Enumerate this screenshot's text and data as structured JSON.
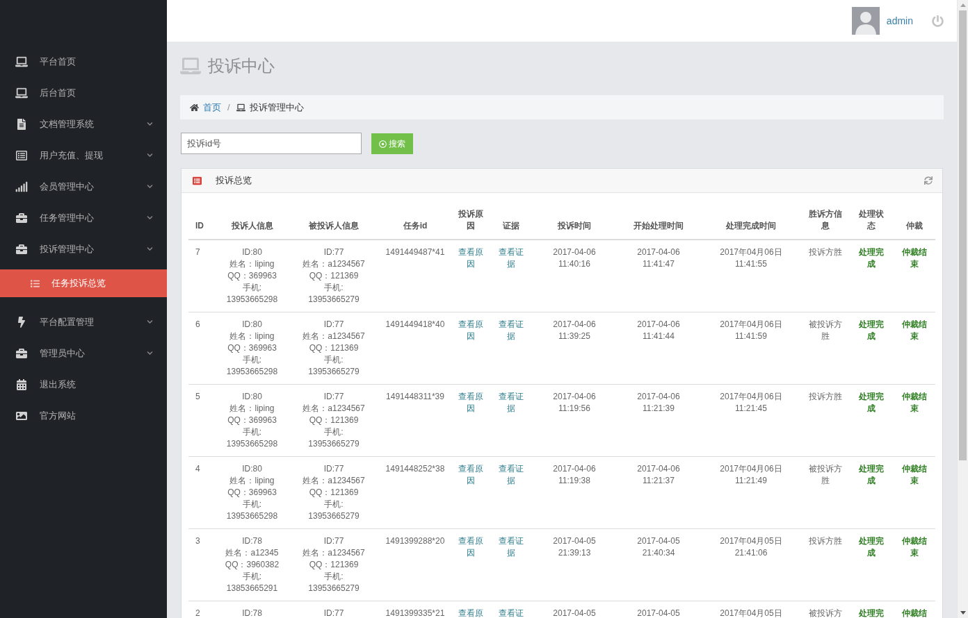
{
  "sidebar": {
    "items": [
      {
        "label": "平台首页",
        "kind": "link",
        "selected": false
      },
      {
        "label": "后台首页",
        "kind": "link",
        "selected": false
      },
      {
        "label": "文档管理系统",
        "kind": "submenu",
        "selected": false
      },
      {
        "label": "用户充值、提现",
        "kind": "submenu",
        "selected": false
      },
      {
        "label": "会员管理中心",
        "kind": "submenu",
        "selected": false
      },
      {
        "label": "任务管理中心",
        "kind": "submenu",
        "selected": false
      },
      {
        "label": "投诉管理中心",
        "kind": "submenu",
        "selected": false,
        "children": [
          {
            "label": "任务投诉总览",
            "selected": true
          }
        ]
      },
      {
        "label": "平台配置管理",
        "kind": "submenu",
        "selected": false
      },
      {
        "label": "管理员中心",
        "kind": "submenu",
        "selected": false
      },
      {
        "label": "退出系统",
        "kind": "link",
        "selected": false
      },
      {
        "label": "官方网站",
        "kind": "link",
        "selected": false
      }
    ]
  },
  "top_bar": {
    "user": "admin"
  },
  "page_title": "投诉中心",
  "breadcrumb": {
    "items": [
      {
        "label": "首页",
        "kind": "link"
      },
      {
        "label": "投诉管理中心",
        "kind": "current"
      }
    ],
    "separator": "/"
  },
  "search": {
    "placeholder": "投诉id号",
    "button": "搜索"
  },
  "panel": {
    "title": "投诉总览",
    "table": {
      "columns": [
        "ID",
        "投诉人信息",
        "被投诉人信息",
        "任务id",
        "投诉原因",
        "证据",
        "投诉时间",
        "开始处理时间",
        "处理完成时间",
        "胜诉方信息",
        "处理状态",
        "仲裁"
      ],
      "rows": [
        {
          "id": "7",
          "complainant": [
            "ID:80",
            "姓名：liping",
            "QQ：369963",
            "手机:",
            "13953665298"
          ],
          "respondent": [
            "ID:77",
            "姓名：a1234567",
            "QQ：121369",
            "手机:",
            "13953665279"
          ],
          "task_id": "1491449487*41",
          "reason": "查看原因",
          "evidence": "查看证据",
          "complaint_time": [
            "2017-04-06",
            "11:40:16"
          ],
          "start_time": [
            "2017-04-06",
            "11:41:47"
          ],
          "finish_time": [
            "2017年04月06日",
            "11:41:55"
          ],
          "winner": "投诉方胜",
          "status": "处理完成",
          "arbitration": "仲裁结束"
        },
        {
          "id": "6",
          "complainant": [
            "ID:80",
            "姓名：liping",
            "QQ：369963",
            "手机:",
            "13953665298"
          ],
          "respondent": [
            "ID:77",
            "姓名：a1234567",
            "QQ：121369",
            "手机:",
            "13953665279"
          ],
          "task_id": "1491449418*40",
          "reason": "查看原因",
          "evidence": "查看证据",
          "complaint_time": [
            "2017-04-06",
            "11:39:25"
          ],
          "start_time": [
            "2017-04-06",
            "11:41:44"
          ],
          "finish_time": [
            "2017年04月06日",
            "11:41:59"
          ],
          "winner": "被投诉方胜",
          "status": "处理完成",
          "arbitration": "仲裁结束"
        },
        {
          "id": "5",
          "complainant": [
            "ID:80",
            "姓名：liping",
            "QQ：369963",
            "手机:",
            "13953665298"
          ],
          "respondent": [
            "ID:77",
            "姓名：a1234567",
            "QQ：121369",
            "手机:",
            "13953665279"
          ],
          "task_id": "1491448311*39",
          "reason": "查看原因",
          "evidence": "查看证据",
          "complaint_time": [
            "2017-04-06",
            "11:19:56"
          ],
          "start_time": [
            "2017-04-06",
            "11:21:39"
          ],
          "finish_time": [
            "2017年04月06日",
            "11:21:45"
          ],
          "winner": "投诉方胜",
          "status": "处理完成",
          "arbitration": "仲裁结束"
        },
        {
          "id": "4",
          "complainant": [
            "ID:80",
            "姓名：liping",
            "QQ：369963",
            "手机:",
            "13953665298"
          ],
          "respondent": [
            "ID:77",
            "姓名：a1234567",
            "QQ：121369",
            "手机:",
            "13953665279"
          ],
          "task_id": "1491448252*38",
          "reason": "查看原因",
          "evidence": "查看证据",
          "complaint_time": [
            "2017-04-06",
            "11:19:38"
          ],
          "start_time": [
            "2017-04-06",
            "11:21:37"
          ],
          "finish_time": [
            "2017年04月06日",
            "11:21:49"
          ],
          "winner": "被投诉方胜",
          "status": "处理完成",
          "arbitration": "仲裁结束"
        },
        {
          "id": "3",
          "complainant": [
            "ID:78",
            "姓名：a12345",
            "QQ：3960382",
            "手机:",
            "13853665291"
          ],
          "respondent": [
            "ID:77",
            "姓名：a1234567",
            "QQ：121369",
            "手机:",
            "13953665279"
          ],
          "task_id": "1491399288*20",
          "reason": "查看原因",
          "evidence": "查看证据",
          "complaint_time": [
            "2017-04-05",
            "21:39:13"
          ],
          "start_time": [
            "2017-04-05",
            "21:40:34"
          ],
          "finish_time": [
            "2017年04月05日",
            "21:41:06"
          ],
          "winner": "投诉方胜",
          "status": "处理完成",
          "arbitration": "仲裁结束"
        },
        {
          "id": "2",
          "complainant": [
            "ID:78"
          ],
          "respondent": [
            "ID:77"
          ],
          "task_id": "1491399335*21",
          "reason": "查看原",
          "evidence": "查看证",
          "complaint_time": [
            "2017-04-05"
          ],
          "start_time": [
            "2017-04-05"
          ],
          "finish_time": [
            "2017年04月05日"
          ],
          "winner": "被投诉方",
          "status": "处理完",
          "arbitration": "仲裁结"
        }
      ]
    }
  }
}
